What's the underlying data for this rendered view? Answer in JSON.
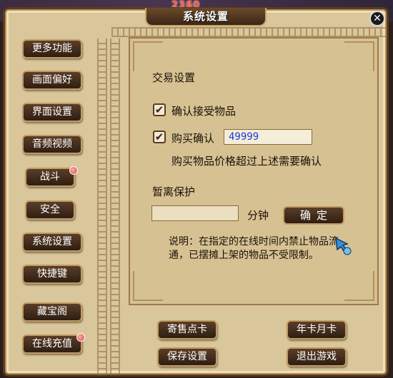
{
  "background": {
    "overlay_number": "2360"
  },
  "window": {
    "title": "系统设置",
    "close_label": "✕"
  },
  "sidebar": {
    "items": [
      {
        "label": "更多功能"
      },
      {
        "label": "画面偏好"
      },
      {
        "label": "界面设置"
      },
      {
        "label": "音频视频"
      },
      {
        "label": "战斗",
        "badge": true
      },
      {
        "label": "安全"
      },
      {
        "label": "系统设置"
      },
      {
        "label": "快捷键"
      },
      {
        "label": "藏宝阁"
      },
      {
        "label": "在线充值",
        "badge": true
      }
    ]
  },
  "trade": {
    "section_title": "交易设置",
    "confirm_receive": {
      "label": "确认接受物品",
      "checked": true
    },
    "purchase_confirm": {
      "label": "购买确认",
      "checked": true,
      "value": "49999"
    },
    "purchase_hint": "购买物品价格超过上述需要确认"
  },
  "away": {
    "section_title": "暂离保护",
    "minutes_value": "",
    "unit_label": "分钟",
    "confirm_label": "确定",
    "note": "说明：在指定的在线时间内禁止物品流通，已摆摊上架的物品不受限制。"
  },
  "bottom": {
    "consign_card": "寄售点卡",
    "year_month_card": "年卡月卡",
    "save_settings": "保存设置",
    "exit_game": "退出游戏"
  },
  "colors": {
    "button_bg": "#3e2a1a",
    "button_border": "#c39a60",
    "panel_bg": "#d6c192",
    "input_text": "#1a3bd6"
  },
  "icons": {
    "check": "✔",
    "cursor": "hand-pointer-icon"
  }
}
